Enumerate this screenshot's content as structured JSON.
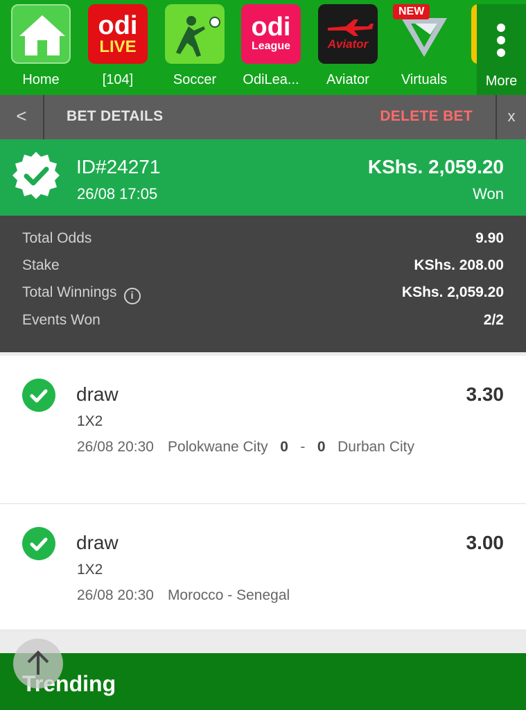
{
  "nav": {
    "items": [
      {
        "label": "Home"
      },
      {
        "label": "[104]",
        "logo_line1": "odi",
        "logo_line2": "LIVE"
      },
      {
        "label": "Soccer"
      },
      {
        "label": "OdiLea...",
        "logo_line1": "odi",
        "logo_line2": "League"
      },
      {
        "label": "Aviator",
        "logo_text": "Aviator"
      },
      {
        "label": "Virtuals",
        "badge": "NEW"
      }
    ],
    "more_label": "More"
  },
  "bar": {
    "back_glyph": "<",
    "title": "BET DETAILS",
    "delete_label": "DELETE BET",
    "close_glyph": "x"
  },
  "summary": {
    "id": "ID#24271",
    "date": "26/08 17:05",
    "amount": "KShs. 2,059.20",
    "status": "Won"
  },
  "stats": [
    {
      "label": "Total Odds",
      "value": "9.90"
    },
    {
      "label": "Stake",
      "value": "KShs. 208.00"
    },
    {
      "label": "Total Winnings",
      "value": "KShs. 2,059.20"
    },
    {
      "label": "Events Won",
      "value": "2/2"
    }
  ],
  "info_glyph": "i",
  "events": [
    {
      "pick": "draw",
      "odds": "3.30",
      "market": "1X2",
      "time": "26/08 20:30",
      "home": "Polokwane City",
      "home_score": "0",
      "sep": "-",
      "away_score": "0",
      "away": "Durban City"
    },
    {
      "pick": "draw",
      "odds": "3.00",
      "market": "1X2",
      "time": "26/08 20:30",
      "match": "Morocco - Senegal"
    }
  ],
  "trending": {
    "label": "Trending"
  },
  "colors": {
    "nav_green": "#13a31d",
    "won_green": "#1eab4f",
    "check_green": "#22b64a",
    "delete_red": "#ff6b6b"
  }
}
